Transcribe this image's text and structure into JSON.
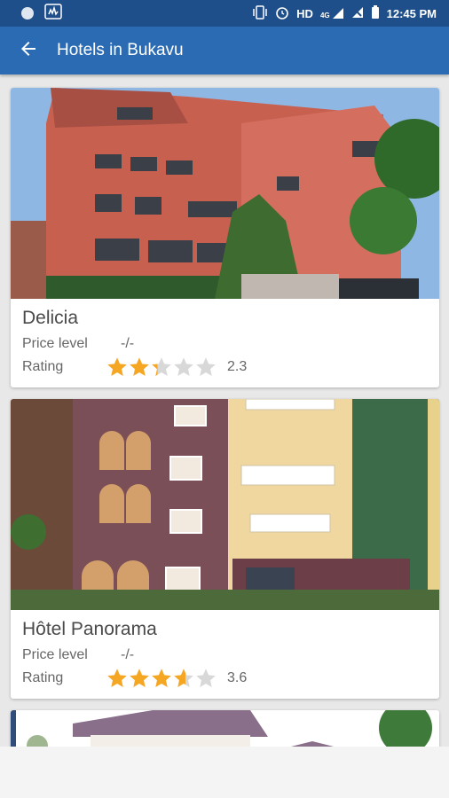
{
  "status_bar": {
    "network": "HD",
    "signal_type": "4G",
    "time": "12:45 PM"
  },
  "app_bar": {
    "title": "Hotels in Bukavu",
    "back_icon": "arrow-back-icon"
  },
  "hotels": [
    {
      "name": "Delicia",
      "price_label": "Price level",
      "price_value": "-/-",
      "rating_label": "Rating",
      "rating": 2.3,
      "rating_text": "2.3"
    },
    {
      "name": "Hôtel Panorama",
      "price_label": "Price level",
      "price_value": "-/-",
      "rating_label": "Rating",
      "rating": 3.6,
      "rating_text": "3.6"
    }
  ],
  "colors": {
    "app_bar": "#2a6bb3",
    "status_bar": "#1f4f8a",
    "star_filled": "#f5a623",
    "star_empty": "#d8d8d8"
  }
}
